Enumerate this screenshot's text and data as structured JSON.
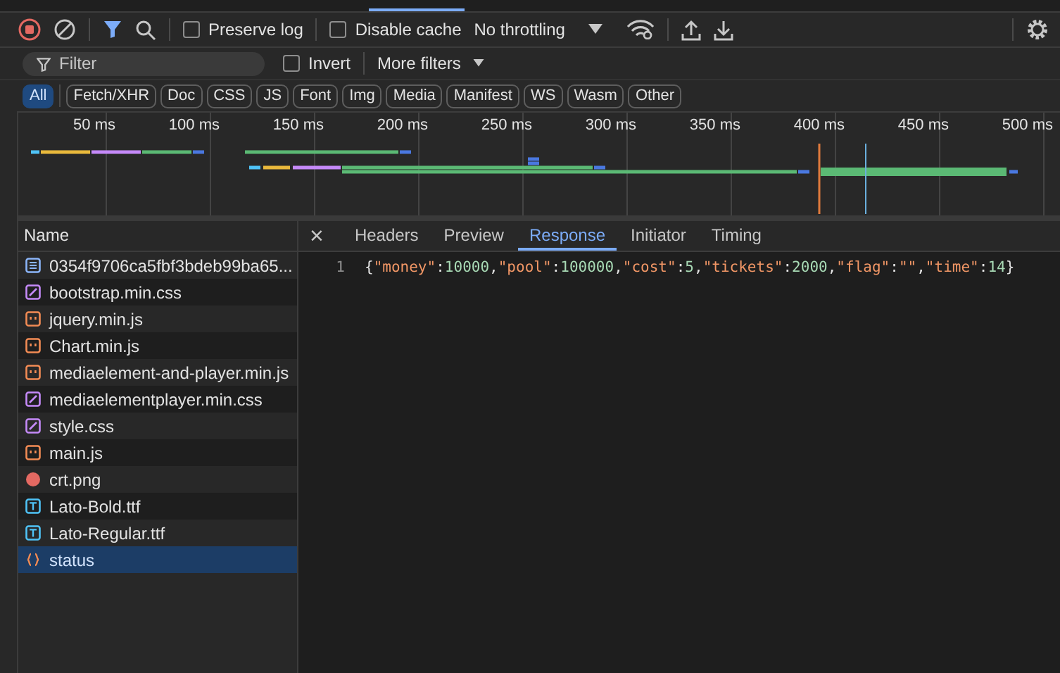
{
  "toolbar": {
    "preserve_log": {
      "label": "Preserve log",
      "checked": false
    },
    "disable_cache": {
      "label": "Disable cache",
      "checked": false
    },
    "throttling": "No throttling"
  },
  "filter": {
    "placeholder": "Filter",
    "invert": {
      "label": "Invert",
      "checked": false
    },
    "more_filters": "More filters"
  },
  "type_filters": [
    {
      "label": "All",
      "selected": true
    },
    {
      "label": "Fetch/XHR",
      "selected": false
    },
    {
      "label": "Doc",
      "selected": false
    },
    {
      "label": "CSS",
      "selected": false
    },
    {
      "label": "JS",
      "selected": false
    },
    {
      "label": "Font",
      "selected": false
    },
    {
      "label": "Img",
      "selected": false
    },
    {
      "label": "Media",
      "selected": false
    },
    {
      "label": "Manifest",
      "selected": false
    },
    {
      "label": "WS",
      "selected": false
    },
    {
      "label": "Wasm",
      "selected": false
    },
    {
      "label": "Other",
      "selected": false
    }
  ],
  "timeline": {
    "ticks": [
      "50 ms",
      "100 ms",
      "150 ms",
      "200 ms",
      "250 ms",
      "300 ms",
      "350 ms",
      "400 ms",
      "450 ms",
      "500 ms"
    ]
  },
  "requests": {
    "column": "Name",
    "rows": [
      {
        "name": "0354f9706ca5fbf3bdeb99ba65...",
        "kind": "doc",
        "selected": false
      },
      {
        "name": "bootstrap.min.css",
        "kind": "css",
        "selected": false
      },
      {
        "name": "jquery.min.js",
        "kind": "js",
        "selected": false
      },
      {
        "name": "Chart.min.js",
        "kind": "js",
        "selected": false
      },
      {
        "name": "mediaelement-and-player.min.js",
        "kind": "js",
        "selected": false
      },
      {
        "name": "mediaelementplayer.min.css",
        "kind": "css",
        "selected": false
      },
      {
        "name": "style.css",
        "kind": "css",
        "selected": false
      },
      {
        "name": "main.js",
        "kind": "js",
        "selected": false
      },
      {
        "name": "crt.png",
        "kind": "image",
        "selected": false
      },
      {
        "name": "Lato-Bold.ttf",
        "kind": "font",
        "selected": false
      },
      {
        "name": "Lato-Regular.ttf",
        "kind": "font",
        "selected": false
      },
      {
        "name": "status",
        "kind": "fetch",
        "selected": true
      }
    ]
  },
  "detail": {
    "close": "×",
    "tabs": [
      {
        "label": "Headers",
        "selected": false
      },
      {
        "label": "Preview",
        "selected": false
      },
      {
        "label": "Response",
        "selected": true
      },
      {
        "label": "Initiator",
        "selected": false
      },
      {
        "label": "Timing",
        "selected": false
      }
    ],
    "lines": [
      {
        "number": "1",
        "tokens": [
          {
            "kind": "punct",
            "text": "{"
          },
          {
            "kind": "key",
            "text": "\"money\""
          },
          {
            "kind": "punct",
            "text": ":"
          },
          {
            "kind": "number",
            "text": "10000"
          },
          {
            "kind": "punct",
            "text": ","
          },
          {
            "kind": "key",
            "text": "\"pool\""
          },
          {
            "kind": "punct",
            "text": ":"
          },
          {
            "kind": "number",
            "text": "100000"
          },
          {
            "kind": "punct",
            "text": ","
          },
          {
            "kind": "key",
            "text": "\"cost\""
          },
          {
            "kind": "punct",
            "text": ":"
          },
          {
            "kind": "number",
            "text": "5"
          },
          {
            "kind": "punct",
            "text": ","
          },
          {
            "kind": "key",
            "text": "\"tickets\""
          },
          {
            "kind": "punct",
            "text": ":"
          },
          {
            "kind": "number",
            "text": "2000"
          },
          {
            "kind": "punct",
            "text": ","
          },
          {
            "kind": "key",
            "text": "\"flag\""
          },
          {
            "kind": "punct",
            "text": ":"
          },
          {
            "kind": "string",
            "text": "\"\""
          },
          {
            "kind": "punct",
            "text": ","
          },
          {
            "kind": "key",
            "text": "\"time\""
          },
          {
            "kind": "punct",
            "text": ":"
          },
          {
            "kind": "number",
            "text": "14"
          },
          {
            "kind": "punct",
            "text": "}"
          }
        ]
      }
    ]
  }
}
